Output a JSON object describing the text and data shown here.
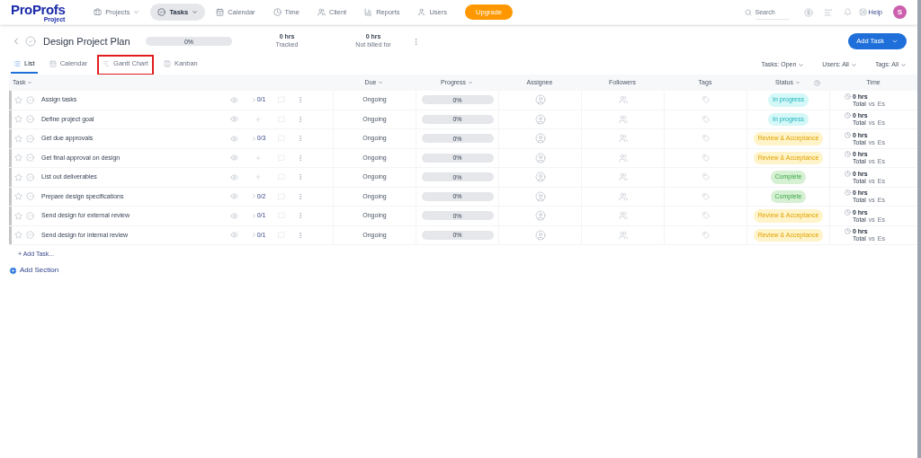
{
  "logo": {
    "brand": "ProProfs",
    "product": "Project"
  },
  "nav": [
    {
      "label": "Projects",
      "selected": false
    },
    {
      "label": "Tasks",
      "selected": true
    },
    {
      "label": "Calendar",
      "selected": false
    },
    {
      "label": "Time",
      "selected": false
    },
    {
      "label": "Client",
      "selected": false
    },
    {
      "label": "Reports",
      "selected": false
    },
    {
      "label": "Users",
      "selected": false
    }
  ],
  "upgrade": "Upgrade",
  "search": {
    "placeholder": "Search"
  },
  "help": "Help",
  "avatar": "S",
  "project": {
    "title": "Design Project Plan",
    "progress": "0%",
    "level": 0,
    "tracked": {
      "value": "0 hrs",
      "label": "Tracked"
    },
    "not_billed": {
      "value": "0 hrs",
      "label": "Not billed for"
    }
  },
  "add_task_button": "Add Task",
  "views": [
    {
      "label": "List",
      "selected": true,
      "highlighted": false
    },
    {
      "label": "Calendar",
      "selected": false,
      "highlighted": false
    },
    {
      "label": "Gantt Chart",
      "selected": false,
      "highlighted": true
    },
    {
      "label": "Kanban",
      "selected": false,
      "highlighted": false
    }
  ],
  "filters": [
    "Tasks: Open",
    "Users: All",
    "Tags: All"
  ],
  "columns": {
    "task": "Task",
    "due": "Due",
    "progress": "Progress",
    "assignee": "Assignee",
    "followers": "Followers",
    "tags": "Tags",
    "status": "Status",
    "time": "Time"
  },
  "rows": [
    {
      "name": "Assign tasks",
      "subtasks": "0/1",
      "due": "Ongoing",
      "progress": "0%",
      "level": 0,
      "status": {
        "label": "In progress",
        "kind": "in_progress"
      },
      "time": {
        "hours": "0 hrs",
        "total": "Total",
        "vs": "vs",
        "estimate": "Es"
      }
    },
    {
      "name": "Define project goal",
      "due": "Ongoing",
      "progress": "0%",
      "level": 0,
      "status": {
        "label": "In progress",
        "kind": "in_progress"
      },
      "time": {
        "hours": "0 hrs",
        "total": "Total",
        "vs": "vs",
        "estimate": "Es"
      }
    },
    {
      "name": "Get due approvals",
      "subtasks": "0/3",
      "due": "Ongoing",
      "progress": "0%",
      "level": 0,
      "status": {
        "label": "Review & Acceptance",
        "kind": "review"
      },
      "time": {
        "hours": "0 hrs",
        "total": "Total",
        "vs": "vs",
        "estimate": "Es"
      }
    },
    {
      "name": "Get final approval on design",
      "due": "Ongoing",
      "progress": "0%",
      "level": 0,
      "status": {
        "label": "Review & Acceptance",
        "kind": "review"
      },
      "time": {
        "hours": "0 hrs",
        "total": "Total",
        "vs": "vs",
        "estimate": "Es"
      }
    },
    {
      "name": "List out deliverables",
      "due": "Ongoing",
      "progress": "0%",
      "level": 0,
      "status": {
        "label": "Complete",
        "kind": "complete"
      },
      "time": {
        "hours": "0 hrs",
        "total": "Total",
        "vs": "vs",
        "estimate": "Es"
      }
    },
    {
      "name": "Prepare design specifications",
      "subtasks": "0/2",
      "due": "Ongoing",
      "progress": "0%",
      "level": 0,
      "status": {
        "label": "Complete",
        "kind": "complete"
      },
      "time": {
        "hours": "0 hrs",
        "total": "Total",
        "vs": "vs",
        "estimate": "Es"
      }
    },
    {
      "name": "Send design for external review",
      "subtasks": "0/1",
      "due": "Ongoing",
      "progress": "0%",
      "level": 0,
      "status": {
        "label": "Review & Acceptance",
        "kind": "review"
      },
      "time": {
        "hours": "0 hrs",
        "total": "Total",
        "vs": "vs",
        "estimate": "Es"
      }
    },
    {
      "name": "Send design for internal review",
      "subtasks": "0/1",
      "due": "Ongoing",
      "progress": "0%",
      "level": 0,
      "status": {
        "label": "Review & Acceptance",
        "kind": "review"
      },
      "time": {
        "hours": "0 hrs",
        "total": "Total",
        "vs": "vs",
        "estimate": "Es"
      }
    }
  ],
  "add_task_link": "+ Add Task...",
  "add_section": "Add Section"
}
